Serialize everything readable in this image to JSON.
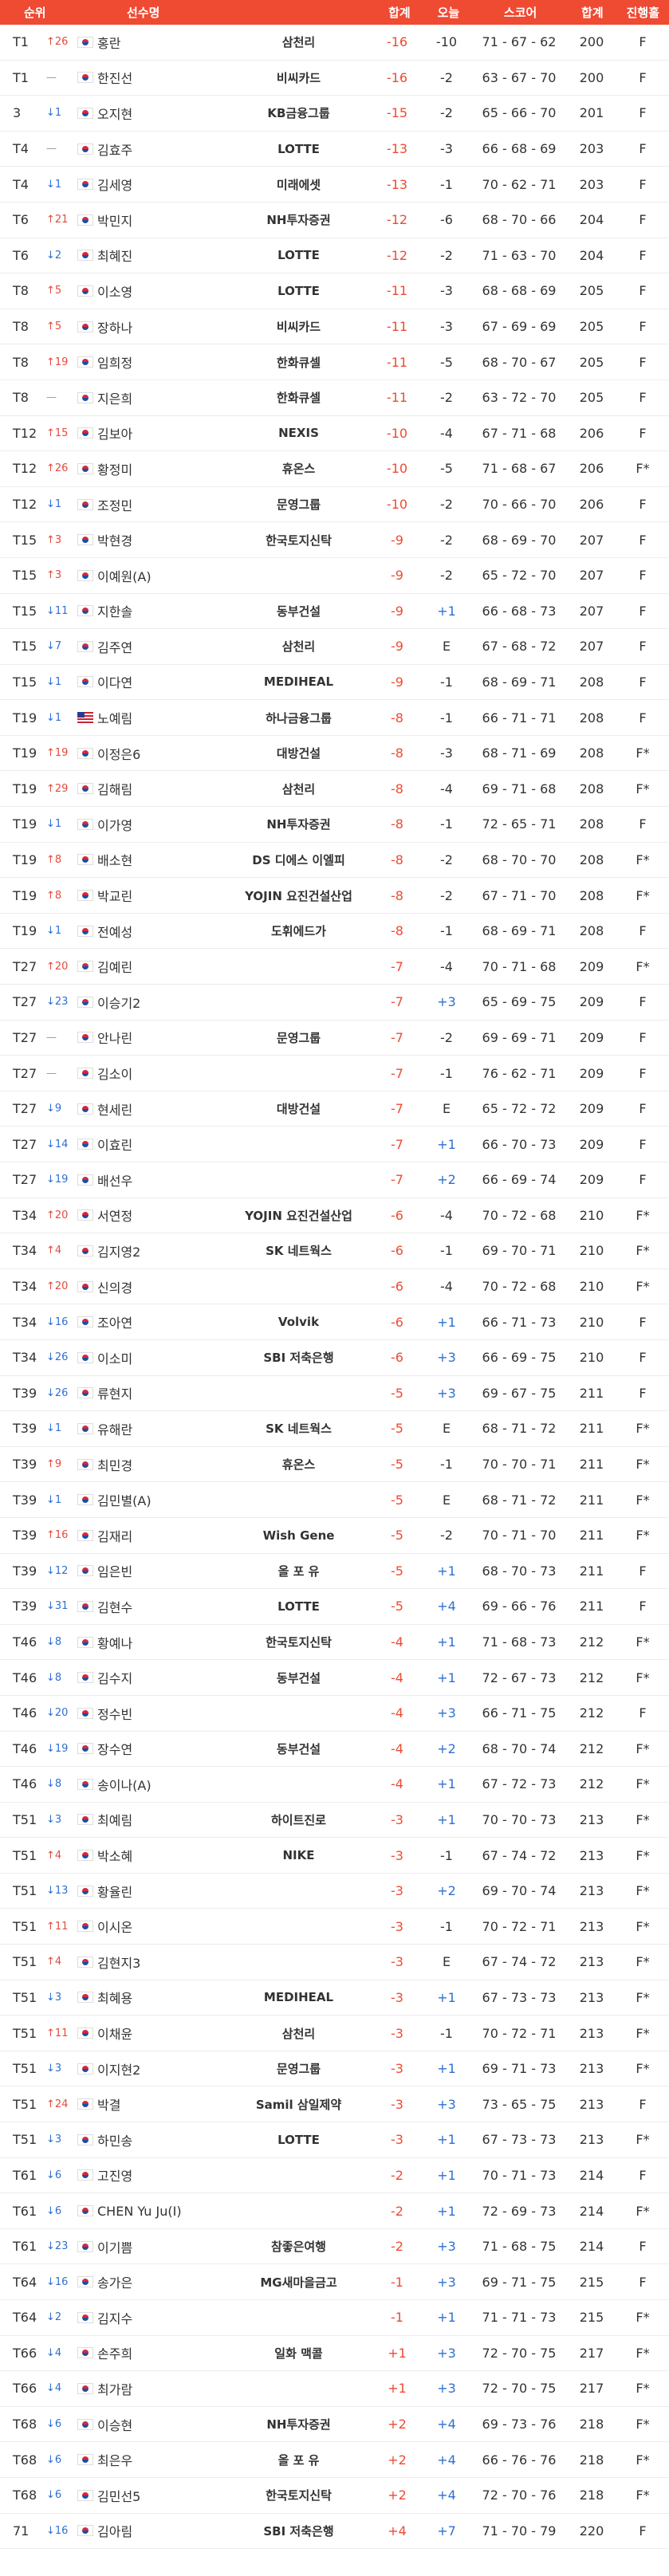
{
  "header": {
    "rank": "순위",
    "player": "선수명",
    "total": "합계",
    "today": "오늘",
    "score": "스코어",
    "sum": "합계",
    "progress": "진행홀"
  },
  "rows": [
    {
      "rank": "T1",
      "move": "↑26",
      "dir": "up",
      "flag": "kr",
      "name": "홍란",
      "sponsor": "삼천리",
      "total": "-16",
      "today": "-10",
      "score": "71 - 67 - 62",
      "sum": "200",
      "prog": "F"
    },
    {
      "rank": "T1",
      "move": "—",
      "dir": "same",
      "flag": "kr",
      "name": "한진선",
      "sponsor": "비씨카드",
      "total": "-16",
      "today": "-2",
      "score": "63 - 67 - 70",
      "sum": "200",
      "prog": "F"
    },
    {
      "rank": "3",
      "move": "↓1",
      "dir": "down",
      "flag": "kr",
      "name": "오지현",
      "sponsor": "KB금융그룹",
      "total": "-15",
      "today": "-2",
      "score": "65 - 66 - 70",
      "sum": "201",
      "prog": "F"
    },
    {
      "rank": "T4",
      "move": "—",
      "dir": "same",
      "flag": "kr",
      "name": "김효주",
      "sponsor": "LOTTE",
      "total": "-13",
      "today": "-3",
      "score": "66 - 68 - 69",
      "sum": "203",
      "prog": "F"
    },
    {
      "rank": "T4",
      "move": "↓1",
      "dir": "down",
      "flag": "kr",
      "name": "김세영",
      "sponsor": "미래에셋",
      "total": "-13",
      "today": "-1",
      "score": "70 - 62 - 71",
      "sum": "203",
      "prog": "F"
    },
    {
      "rank": "T6",
      "move": "↑21",
      "dir": "up",
      "flag": "kr",
      "name": "박민지",
      "sponsor": "NH투자증권",
      "total": "-12",
      "today": "-6",
      "score": "68 - 70 - 66",
      "sum": "204",
      "prog": "F"
    },
    {
      "rank": "T6",
      "move": "↓2",
      "dir": "down",
      "flag": "kr",
      "name": "최혜진",
      "sponsor": "LOTTE",
      "total": "-12",
      "today": "-2",
      "score": "71 - 63 - 70",
      "sum": "204",
      "prog": "F"
    },
    {
      "rank": "T8",
      "move": "↑5",
      "dir": "up",
      "flag": "kr",
      "name": "이소영",
      "sponsor": "LOTTE",
      "total": "-11",
      "today": "-3",
      "score": "68 - 68 - 69",
      "sum": "205",
      "prog": "F"
    },
    {
      "rank": "T8",
      "move": "↑5",
      "dir": "up",
      "flag": "kr",
      "name": "장하나",
      "sponsor": "비씨카드",
      "total": "-11",
      "today": "-3",
      "score": "67 - 69 - 69",
      "sum": "205",
      "prog": "F"
    },
    {
      "rank": "T8",
      "move": "↑19",
      "dir": "up",
      "flag": "kr",
      "name": "임희정",
      "sponsor": "한화큐셀",
      "total": "-11",
      "today": "-5",
      "score": "68 - 70 - 67",
      "sum": "205",
      "prog": "F"
    },
    {
      "rank": "T8",
      "move": "—",
      "dir": "same",
      "flag": "kr",
      "name": "지은희",
      "sponsor": "한화큐셀",
      "total": "-11",
      "today": "-2",
      "score": "63 - 72 - 70",
      "sum": "205",
      "prog": "F"
    },
    {
      "rank": "T12",
      "move": "↑15",
      "dir": "up",
      "flag": "kr",
      "name": "김보아",
      "sponsor": "NEXIS",
      "total": "-10",
      "today": "-4",
      "score": "67 - 71 - 68",
      "sum": "206",
      "prog": "F"
    },
    {
      "rank": "T12",
      "move": "↑26",
      "dir": "up",
      "flag": "kr",
      "name": "황정미",
      "sponsor": "휴온스",
      "total": "-10",
      "today": "-5",
      "score": "71 - 68 - 67",
      "sum": "206",
      "prog": "F*"
    },
    {
      "rank": "T12",
      "move": "↓1",
      "dir": "down",
      "flag": "kr",
      "name": "조정민",
      "sponsor": "문영그룹",
      "total": "-10",
      "today": "-2",
      "score": "70 - 66 - 70",
      "sum": "206",
      "prog": "F"
    },
    {
      "rank": "T15",
      "move": "↑3",
      "dir": "up",
      "flag": "kr",
      "name": "박현경",
      "sponsor": "한국토지신탁",
      "total": "-9",
      "today": "-2",
      "score": "68 - 69 - 70",
      "sum": "207",
      "prog": "F"
    },
    {
      "rank": "T15",
      "move": "↑3",
      "dir": "up",
      "flag": "kr",
      "name": "이예원(A)",
      "sponsor": "",
      "total": "-9",
      "today": "-2",
      "score": "65 - 72 - 70",
      "sum": "207",
      "prog": "F"
    },
    {
      "rank": "T15",
      "move": "↓11",
      "dir": "down",
      "flag": "kr",
      "name": "지한솔",
      "sponsor": "동부건설",
      "total": "-9",
      "today": "+1",
      "score": "66 - 68 - 73",
      "sum": "207",
      "prog": "F"
    },
    {
      "rank": "T15",
      "move": "↓7",
      "dir": "down",
      "flag": "kr",
      "name": "김주연",
      "sponsor": "삼천리",
      "total": "-9",
      "today": "E",
      "score": "67 - 68 - 72",
      "sum": "207",
      "prog": "F"
    },
    {
      "rank": "T15",
      "move": "↓1",
      "dir": "down",
      "flag": "kr",
      "name": "이다연",
      "sponsor": "MEDIHEAL",
      "total": "-9",
      "today": "-1",
      "score": "68 - 69 - 71",
      "sum": "208",
      "prog": "F"
    },
    {
      "rank": "T19",
      "move": "↓1",
      "dir": "down",
      "flag": "us",
      "name": "노예림",
      "sponsor": "하나금융그룹",
      "total": "-8",
      "today": "-1",
      "score": "66 - 71 - 71",
      "sum": "208",
      "prog": "F"
    },
    {
      "rank": "T19",
      "move": "↑19",
      "dir": "up",
      "flag": "kr",
      "name": "이정은6",
      "sponsor": "대방건설",
      "total": "-8",
      "today": "-3",
      "score": "68 - 71 - 69",
      "sum": "208",
      "prog": "F*"
    },
    {
      "rank": "T19",
      "move": "↑29",
      "dir": "up",
      "flag": "kr",
      "name": "김해림",
      "sponsor": "삼천리",
      "total": "-8",
      "today": "-4",
      "score": "69 - 71 - 68",
      "sum": "208",
      "prog": "F*"
    },
    {
      "rank": "T19",
      "move": "↓1",
      "dir": "down",
      "flag": "kr",
      "name": "이가영",
      "sponsor": "NH투자증권",
      "total": "-8",
      "today": "-1",
      "score": "72 - 65 - 71",
      "sum": "208",
      "prog": "F"
    },
    {
      "rank": "T19",
      "move": "↑8",
      "dir": "up",
      "flag": "kr",
      "name": "배소현",
      "sponsor": "DS 디에스 이엘피",
      "total": "-8",
      "today": "-2",
      "score": "68 - 70 - 70",
      "sum": "208",
      "prog": "F*"
    },
    {
      "rank": "T19",
      "move": "↑8",
      "dir": "up",
      "flag": "kr",
      "name": "박교린",
      "sponsor": "YOJIN 요진건설산업",
      "total": "-8",
      "today": "-2",
      "score": "67 - 71 - 70",
      "sum": "208",
      "prog": "F*"
    },
    {
      "rank": "T19",
      "move": "↓1",
      "dir": "down",
      "flag": "kr",
      "name": "전예성",
      "sponsor": "도휘에드가",
      "total": "-8",
      "today": "-1",
      "score": "68 - 69 - 71",
      "sum": "208",
      "prog": "F"
    },
    {
      "rank": "T27",
      "move": "↑20",
      "dir": "up",
      "flag": "kr",
      "name": "김예린",
      "sponsor": "",
      "total": "-7",
      "today": "-4",
      "score": "70 - 71 - 68",
      "sum": "209",
      "prog": "F*"
    },
    {
      "rank": "T27",
      "move": "↓23",
      "dir": "down",
      "flag": "kr",
      "name": "이승기2",
      "sponsor": "",
      "total": "-7",
      "today": "+3",
      "score": "65 - 69 - 75",
      "sum": "209",
      "prog": "F"
    },
    {
      "rank": "T27",
      "move": "—",
      "dir": "same",
      "flag": "kr",
      "name": "안나린",
      "sponsor": "문영그룹",
      "total": "-7",
      "today": "-2",
      "score": "69 - 69 - 71",
      "sum": "209",
      "prog": "F"
    },
    {
      "rank": "T27",
      "move": "—",
      "dir": "same",
      "flag": "kr",
      "name": "김소이",
      "sponsor": "",
      "total": "-7",
      "today": "-1",
      "score": "76 - 62 - 71",
      "sum": "209",
      "prog": "F"
    },
    {
      "rank": "T27",
      "move": "↓9",
      "dir": "down",
      "flag": "kr",
      "name": "현세린",
      "sponsor": "대방건설",
      "total": "-7",
      "today": "E",
      "score": "65 - 72 - 72",
      "sum": "209",
      "prog": "F"
    },
    {
      "rank": "T27",
      "move": "↓14",
      "dir": "down",
      "flag": "kr",
      "name": "이효린",
      "sponsor": "",
      "total": "-7",
      "today": "+1",
      "score": "66 - 70 - 73",
      "sum": "209",
      "prog": "F"
    },
    {
      "rank": "T27",
      "move": "↓19",
      "dir": "down",
      "flag": "kr",
      "name": "배선우",
      "sponsor": "",
      "total": "-7",
      "today": "+2",
      "score": "66 - 69 - 74",
      "sum": "209",
      "prog": "F"
    },
    {
      "rank": "T34",
      "move": "↑20",
      "dir": "up",
      "flag": "kr",
      "name": "서연정",
      "sponsor": "YOJIN 요진건설산업",
      "total": "-6",
      "today": "-4",
      "score": "70 - 72 - 68",
      "sum": "210",
      "prog": "F*"
    },
    {
      "rank": "T34",
      "move": "↑4",
      "dir": "up",
      "flag": "kr",
      "name": "김지영2",
      "sponsor": "SK 네트웍스",
      "total": "-6",
      "today": "-1",
      "score": "69 - 70 - 71",
      "sum": "210",
      "prog": "F*"
    },
    {
      "rank": "T34",
      "move": "↑20",
      "dir": "up",
      "flag": "kr",
      "name": "신의경",
      "sponsor": "",
      "total": "-6",
      "today": "-4",
      "score": "70 - 72 - 68",
      "sum": "210",
      "prog": "F*"
    },
    {
      "rank": "T34",
      "move": "↓16",
      "dir": "down",
      "flag": "kr",
      "name": "조아연",
      "sponsor": "Volvik",
      "total": "-6",
      "today": "+1",
      "score": "66 - 71 - 73",
      "sum": "210",
      "prog": "F"
    },
    {
      "rank": "T34",
      "move": "↓26",
      "dir": "down",
      "flag": "kr",
      "name": "이소미",
      "sponsor": "SBI 저축은행",
      "total": "-6",
      "today": "+3",
      "score": "66 - 69 - 75",
      "sum": "210",
      "prog": "F"
    },
    {
      "rank": "T39",
      "move": "↓26",
      "dir": "down",
      "flag": "kr",
      "name": "류현지",
      "sponsor": "",
      "total": "-5",
      "today": "+3",
      "score": "69 - 67 - 75",
      "sum": "211",
      "prog": "F"
    },
    {
      "rank": "T39",
      "move": "↓1",
      "dir": "down",
      "flag": "kr",
      "name": "유해란",
      "sponsor": "SK 네트웍스",
      "total": "-5",
      "today": "E",
      "score": "68 - 71 - 72",
      "sum": "211",
      "prog": "F*"
    },
    {
      "rank": "T39",
      "move": "↑9",
      "dir": "up",
      "flag": "kr",
      "name": "최민경",
      "sponsor": "휴온스",
      "total": "-5",
      "today": "-1",
      "score": "70 - 70 - 71",
      "sum": "211",
      "prog": "F*"
    },
    {
      "rank": "T39",
      "move": "↓1",
      "dir": "down",
      "flag": "kr",
      "name": "김민별(A)",
      "sponsor": "",
      "total": "-5",
      "today": "E",
      "score": "68 - 71 - 72",
      "sum": "211",
      "prog": "F*"
    },
    {
      "rank": "T39",
      "move": "↑16",
      "dir": "up",
      "flag": "kr",
      "name": "김재리",
      "sponsor": "Wish Gene",
      "total": "-5",
      "today": "-2",
      "score": "70 - 71 - 70",
      "sum": "211",
      "prog": "F*"
    },
    {
      "rank": "T39",
      "move": "↓12",
      "dir": "down",
      "flag": "kr",
      "name": "임은빈",
      "sponsor": "올 포 유",
      "total": "-5",
      "today": "+1",
      "score": "68 - 70 - 73",
      "sum": "211",
      "prog": "F"
    },
    {
      "rank": "T39",
      "move": "↓31",
      "dir": "down",
      "flag": "kr",
      "name": "김현수",
      "sponsor": "LOTTE",
      "total": "-5",
      "today": "+4",
      "score": "69 - 66 - 76",
      "sum": "211",
      "prog": "F"
    },
    {
      "rank": "T46",
      "move": "↓8",
      "dir": "down",
      "flag": "kr",
      "name": "황예나",
      "sponsor": "한국토지신탁",
      "total": "-4",
      "today": "+1",
      "score": "71 - 68 - 73",
      "sum": "212",
      "prog": "F*"
    },
    {
      "rank": "T46",
      "move": "↓8",
      "dir": "down",
      "flag": "kr",
      "name": "김수지",
      "sponsor": "동부건설",
      "total": "-4",
      "today": "+1",
      "score": "72 - 67 - 73",
      "sum": "212",
      "prog": "F*"
    },
    {
      "rank": "T46",
      "move": "↓20",
      "dir": "down",
      "flag": "kr",
      "name": "정수빈",
      "sponsor": "",
      "total": "-4",
      "today": "+3",
      "score": "66 - 71 - 75",
      "sum": "212",
      "prog": "F"
    },
    {
      "rank": "T46",
      "move": "↓19",
      "dir": "down",
      "flag": "kr",
      "name": "장수연",
      "sponsor": "동부건설",
      "total": "-4",
      "today": "+2",
      "score": "68 - 70 - 74",
      "sum": "212",
      "prog": "F*"
    },
    {
      "rank": "T46",
      "move": "↓8",
      "dir": "down",
      "flag": "kr",
      "name": "송이나(A)",
      "sponsor": "",
      "total": "-4",
      "today": "+1",
      "score": "67 - 72 - 73",
      "sum": "212",
      "prog": "F*"
    },
    {
      "rank": "T51",
      "move": "↓3",
      "dir": "down",
      "flag": "kr",
      "name": "최예림",
      "sponsor": "하이트진로",
      "total": "-3",
      "today": "+1",
      "score": "70 - 70 - 73",
      "sum": "213",
      "prog": "F*"
    },
    {
      "rank": "T51",
      "move": "↑4",
      "dir": "up",
      "flag": "kr",
      "name": "박소혜",
      "sponsor": "NIKE",
      "total": "-3",
      "today": "-1",
      "score": "67 - 74 - 72",
      "sum": "213",
      "prog": "F*"
    },
    {
      "rank": "T51",
      "move": "↓13",
      "dir": "down",
      "flag": "kr",
      "name": "황율린",
      "sponsor": "",
      "total": "-3",
      "today": "+2",
      "score": "69 - 70 - 74",
      "sum": "213",
      "prog": "F*"
    },
    {
      "rank": "T51",
      "move": "↑11",
      "dir": "up",
      "flag": "kr",
      "name": "이시온",
      "sponsor": "",
      "total": "-3",
      "today": "-1",
      "score": "70 - 72 - 71",
      "sum": "213",
      "prog": "F*"
    },
    {
      "rank": "T51",
      "move": "↑4",
      "dir": "up",
      "flag": "kr",
      "name": "김현지3",
      "sponsor": "",
      "total": "-3",
      "today": "E",
      "score": "67 - 74 - 72",
      "sum": "213",
      "prog": "F*"
    },
    {
      "rank": "T51",
      "move": "↓3",
      "dir": "down",
      "flag": "kr",
      "name": "최혜용",
      "sponsor": "MEDIHEAL",
      "total": "-3",
      "today": "+1",
      "score": "67 - 73 - 73",
      "sum": "213",
      "prog": "F*"
    },
    {
      "rank": "T51",
      "move": "↑11",
      "dir": "up",
      "flag": "kr",
      "name": "이채윤",
      "sponsor": "삼천리",
      "total": "-3",
      "today": "-1",
      "score": "70 - 72 - 71",
      "sum": "213",
      "prog": "F*"
    },
    {
      "rank": "T51",
      "move": "↓3",
      "dir": "down",
      "flag": "kr",
      "name": "이지현2",
      "sponsor": "문영그룹",
      "total": "-3",
      "today": "+1",
      "score": "69 - 71 - 73",
      "sum": "213",
      "prog": "F*"
    },
    {
      "rank": "T51",
      "move": "↑24",
      "dir": "up",
      "flag": "kr",
      "name": "박결",
      "sponsor": "Samil 삼일제약",
      "total": "-3",
      "today": "+3",
      "score": "73 - 65 - 75",
      "sum": "213",
      "prog": "F"
    },
    {
      "rank": "T51",
      "move": "↓3",
      "dir": "down",
      "flag": "kr",
      "name": "하민송",
      "sponsor": "LOTTE",
      "total": "-3",
      "today": "+1",
      "score": "67 - 73 - 73",
      "sum": "213",
      "prog": "F*"
    },
    {
      "rank": "T61",
      "move": "↓6",
      "dir": "down",
      "flag": "kr",
      "name": "고진영",
      "sponsor": "",
      "total": "-2",
      "today": "+1",
      "score": "70 - 71 - 73",
      "sum": "214",
      "prog": "F"
    },
    {
      "rank": "T61",
      "move": "↓6",
      "dir": "down",
      "flag": "kr",
      "name": "CHEN Yu Ju(I)",
      "sponsor": "",
      "total": "-2",
      "today": "+1",
      "score": "72 - 69 - 73",
      "sum": "214",
      "prog": "F*"
    },
    {
      "rank": "T61",
      "move": "↓23",
      "dir": "down",
      "flag": "kr",
      "name": "이기쁨",
      "sponsor": "참좋은여행",
      "total": "-2",
      "today": "+3",
      "score": "71 - 68 - 75",
      "sum": "214",
      "prog": "F"
    },
    {
      "rank": "T64",
      "move": "↓16",
      "dir": "down",
      "flag": "kr",
      "name": "송가은",
      "sponsor": "MG새마을금고",
      "total": "-1",
      "today": "+3",
      "score": "69 - 71 - 75",
      "sum": "215",
      "prog": "F"
    },
    {
      "rank": "T64",
      "move": "↓2",
      "dir": "down",
      "flag": "kr",
      "name": "김지수",
      "sponsor": "",
      "total": "-1",
      "today": "+1",
      "score": "71 - 71 - 73",
      "sum": "215",
      "prog": "F*"
    },
    {
      "rank": "T66",
      "move": "↓4",
      "dir": "down",
      "flag": "kr",
      "name": "손주희",
      "sponsor": "일화 맥콜",
      "total": "+1",
      "today": "+3",
      "score": "72 - 70 - 75",
      "sum": "217",
      "prog": "F*"
    },
    {
      "rank": "T66",
      "move": "↓4",
      "dir": "down",
      "flag": "kr",
      "name": "최가람",
      "sponsor": "",
      "total": "+1",
      "today": "+3",
      "score": "72 - 70 - 75",
      "sum": "217",
      "prog": "F*"
    },
    {
      "rank": "T68",
      "move": "↓6",
      "dir": "down",
      "flag": "kr",
      "name": "이승현",
      "sponsor": "NH투자증권",
      "total": "+2",
      "today": "+4",
      "score": "69 - 73 - 76",
      "sum": "218",
      "prog": "F*"
    },
    {
      "rank": "T68",
      "move": "↓6",
      "dir": "down",
      "flag": "kr",
      "name": "최은우",
      "sponsor": "올 포 유",
      "total": "+2",
      "today": "+4",
      "score": "66 - 76 - 76",
      "sum": "218",
      "prog": "F*"
    },
    {
      "rank": "T68",
      "move": "↓6",
      "dir": "down",
      "flag": "kr",
      "name": "김민선5",
      "sponsor": "한국토지신탁",
      "total": "+2",
      "today": "+4",
      "score": "72 - 70 - 76",
      "sum": "218",
      "prog": "F*"
    },
    {
      "rank": "71",
      "move": "↓16",
      "dir": "down",
      "flag": "kr",
      "name": "김아림",
      "sponsor": "SBI 저축은행",
      "total": "+4",
      "today": "+7",
      "score": "71 - 70 - 79",
      "sum": "220",
      "prog": "F"
    }
  ],
  "colors": {
    "accent": "#ef4a32",
    "up": "#e44a3c",
    "down": "#2f6fd1"
  }
}
